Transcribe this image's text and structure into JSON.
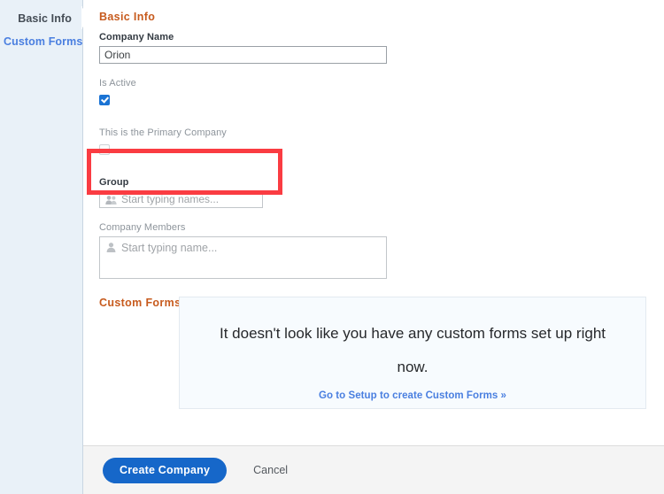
{
  "sidebar": {
    "items": [
      {
        "label": "Basic Info",
        "active": true
      },
      {
        "label": "Custom Forms",
        "active": false
      }
    ]
  },
  "main": {
    "basic_info": {
      "heading": "Basic Info",
      "company_name": {
        "label": "Company Name",
        "value": "Orion"
      },
      "is_active": {
        "label": "Is Active",
        "checked": true
      },
      "primary_company": {
        "label": "This is the Primary Company",
        "checked": false
      },
      "group": {
        "label": "Group",
        "placeholder": "Start typing names...",
        "icon": "group-people-icon",
        "value": ""
      },
      "company_members": {
        "label": "Company Members",
        "placeholder": "Start typing name...",
        "icon": "person-icon",
        "value": ""
      }
    },
    "custom_forms": {
      "heading": "Custom Forms",
      "empty_message": "It doesn't look like you have any custom forms set up right now.",
      "empty_link": "Go to Setup to create Custom Forms »"
    }
  },
  "footer": {
    "primary_label": "Create Company",
    "cancel_label": "Cancel"
  },
  "annotation": {
    "target": "group-field",
    "color": "#fa3c42"
  },
  "colors": {
    "accent_orange": "#c75b1e",
    "link_blue": "#4a7fe0",
    "primary_button": "#1667c9",
    "sidebar_bg": "#e9f1f8",
    "highlight_red": "#fa3c42"
  }
}
